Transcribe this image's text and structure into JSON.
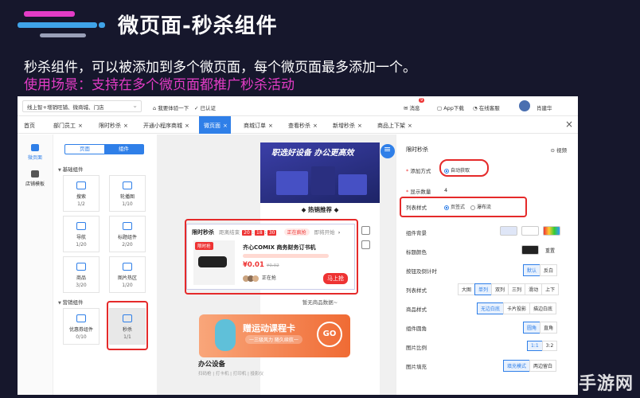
{
  "slide": {
    "title": "微页面-秒杀组件",
    "subtitle_line1": "秒杀组件，可以被添加到多个微页面，每个微页面最多添加一个。",
    "subtitle_line2": "使用场景：支持在多个微页面都推广秒杀活动",
    "accent_color": "#e33cc6",
    "watermark": "华手游网"
  },
  "topbar": {
    "store_select": "线上智+增销旺铺、微商城、门店",
    "try_label": "我要体验一下",
    "verified": "已认证",
    "message": "消息",
    "message_count": "9",
    "app_download": "App下载",
    "online_service": "在线客服",
    "username": "肖建华"
  },
  "tabs": [
    {
      "label": "首页"
    },
    {
      "label": "部门员工"
    },
    {
      "label": "限时秒杀"
    },
    {
      "label": "开通小程序商城"
    },
    {
      "label": "微页面",
      "active": true
    },
    {
      "label": "商城订单"
    },
    {
      "label": "查看秒杀"
    },
    {
      "label": "新增秒杀"
    },
    {
      "label": "商品上下架"
    }
  ],
  "leftnav": {
    "micro_page": "微页面",
    "store_template": "店铺模板"
  },
  "components": {
    "tab_page": "页面",
    "tab_component": "组件",
    "group_basic": "基础组件",
    "group_marketing": "营销组件",
    "items": [
      {
        "name": "搜索",
        "count": "1/2"
      },
      {
        "name": "轮播图",
        "count": "1/10"
      },
      {
        "name": "导航",
        "count": "1/20"
      },
      {
        "name": "标题组件",
        "count": "2/20"
      },
      {
        "name": "商品",
        "count": "3/20"
      },
      {
        "name": "图片热区",
        "count": "1/20"
      },
      {
        "name": "优惠券组件",
        "count": "0/10"
      },
      {
        "name": "秒杀",
        "count": "1/1"
      }
    ]
  },
  "preview": {
    "banner_text": "职选好设备 办公更高效",
    "hot_title": "热销推荐",
    "seckill": {
      "title": "限时秒杀",
      "ends_label": "距离结束",
      "digits": [
        "20",
        "18",
        "30"
      ],
      "tab_active": "正在疯抢",
      "tab_next": "即将开始",
      "badge": "限时抢",
      "product": "齐心COMIX 商务财务订书机",
      "price": "¥0.01",
      "old_price": "¥0.02",
      "status": "正在抢",
      "buy_button": "马上抢"
    },
    "no_data": "暂无商品数据~",
    "banner2_title": "赠运动课程卡",
    "banner2_sub": "一三级风力 随久续航一",
    "banner2_go": "GO",
    "office_title": "办公设备",
    "office_sub": "扫码枪 | 打卡机 | 打印机 | 投影仪"
  },
  "settings": {
    "title": "限时秒杀",
    "video": "视频",
    "add_method_label": "添加方式",
    "add_method_value": "自动获取",
    "display_count_label": "显示数量",
    "display_count_value": "4",
    "list_style_label": "列表样式",
    "list_style_opt1": "页签式",
    "list_style_opt2": "瀑布流",
    "bg_label": "组件背景",
    "title_color_label": "标题颜色",
    "title_color_reset": "重置",
    "btn_countdown_label": "按钮及倒计时",
    "btn_opts": [
      "默认",
      "反白"
    ],
    "list_style2_label": "列表样式",
    "list_opts": [
      "大图",
      "单列",
      "双列",
      "三列",
      "滑动",
      "上下"
    ],
    "goods_style_label": "商品样式",
    "goods_opts": [
      "无边白底",
      "卡片投影",
      "描边白底"
    ],
    "corner_label": "组件圆角",
    "corner_opts": [
      "圆角",
      "直角"
    ],
    "ratio_label": "图片比例",
    "ratio_opts": [
      "1:1",
      "3:2"
    ],
    "fill_label": "图片填充",
    "fill_opts": [
      "填充模式",
      "两边留白"
    ]
  }
}
